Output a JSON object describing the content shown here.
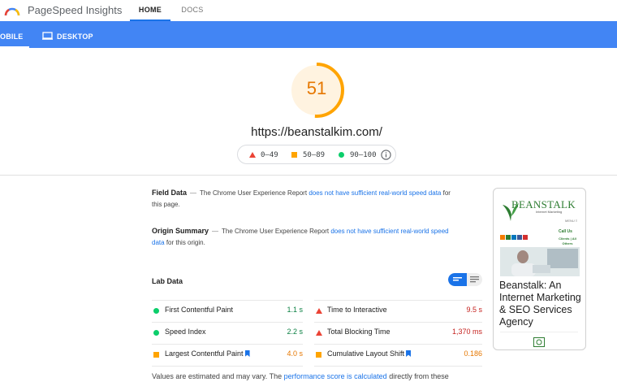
{
  "app": {
    "brand": "PageSpeed Insights",
    "nav": [
      {
        "label": "HOME",
        "active": true
      },
      {
        "label": "DOCS",
        "active": false
      }
    ]
  },
  "devices": {
    "mobile_label": "OBILE",
    "desktop_label": "DESKTOP",
    "active": "mobile"
  },
  "score": {
    "value": "51",
    "fraction": 0.51,
    "color": "#ffa400",
    "url": "https://beanstalkim.com/"
  },
  "legend": {
    "fail": "0–49",
    "average": "50–89",
    "pass": "90–100"
  },
  "field_data": {
    "title": "Field Data",
    "text_pre": "The Chrome User Experience Report",
    "link": "does not have sufficient real-world speed data",
    "text_post": "for this page."
  },
  "origin_summary": {
    "title": "Origin Summary",
    "text_pre": "The Chrome User Experience Report",
    "link": "does not have sufficient real-world speed data",
    "text_post": "for this origin."
  },
  "lab_data": {
    "title": "Lab Data",
    "view": "list",
    "metrics": [
      {
        "label": "First Contentful Paint",
        "value": "1.1 s",
        "status": "good",
        "flag": false
      },
      {
        "label": "Time to Interactive",
        "value": "9.5 s",
        "status": "fail",
        "flag": false
      },
      {
        "label": "Speed Index",
        "value": "2.2 s",
        "status": "good",
        "flag": false
      },
      {
        "label": "Total Blocking Time",
        "value": "1,370 ms",
        "status": "fail",
        "flag": false
      },
      {
        "label": "Largest Contentful Paint",
        "value": "4.0 s",
        "status": "average",
        "flag": true
      },
      {
        "label": "Cumulative Layout Shift",
        "value": "0.186",
        "status": "average",
        "flag": true
      }
    ]
  },
  "footer": {
    "pre": "Values are estimated and may vary. The",
    "link": "performance score is calculated",
    "post": "directly from these"
  },
  "preview": {
    "logo_text": "BEANSTALK",
    "tagline": "Internet Marketing",
    "menu": "MENU ≡",
    "call_us": "Call Us",
    "clients": "Clients | All Others",
    "title": "Beanstalk: An Internet Marketing & SEO Services Agency"
  },
  "colors": {
    "accent_blue": "#4285f4",
    "link_blue": "#1a73e8",
    "pass": "#0cce6b",
    "average": "#ffa400",
    "fail": "#eb4335"
  }
}
